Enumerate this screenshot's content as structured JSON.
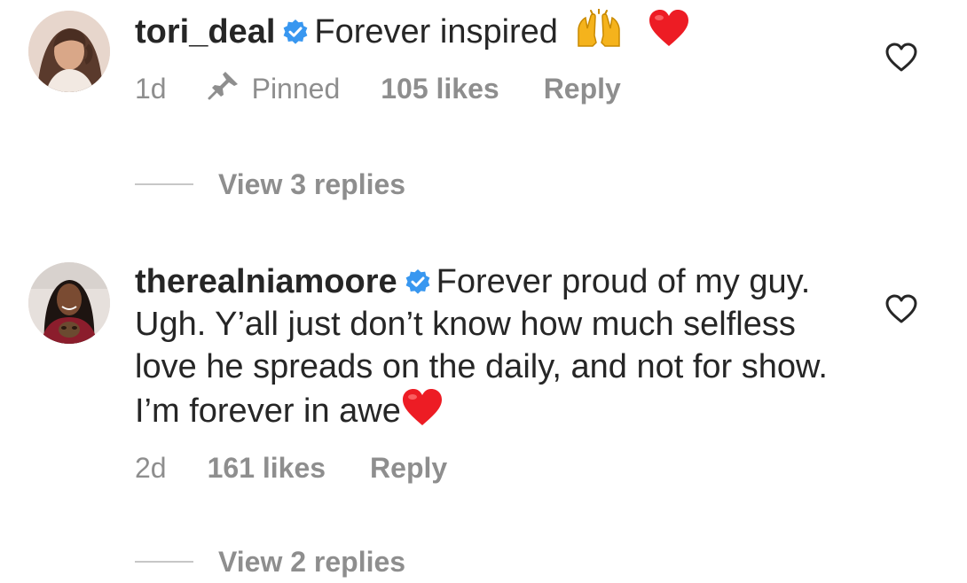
{
  "comments": [
    {
      "username": "tori_deal",
      "avatar": "profile-photo-woman-brown-hair",
      "verified_icon": "verified-badge-icon",
      "text": "Forever inspired",
      "emojis": [
        "raising-hands-emoji",
        "red-heart-emoji"
      ],
      "time": "1d",
      "pinned_label": "Pinned",
      "likes": "105 likes",
      "reply_label": "Reply",
      "view_replies": "View 3 replies"
    },
    {
      "username": "therealniamoore",
      "avatar": "profile-photo-woman-with-dog",
      "verified_icon": "verified-badge-icon",
      "text": "Forever proud of my guy. Ugh. Y’all just don’t know how much selfless love he spreads on the daily, and not for show. I’m forever in awe",
      "emojis": [
        "red-heart-emoji"
      ],
      "time": "2d",
      "likes": "161 likes",
      "reply_label": "Reply",
      "view_replies": "View 2 replies"
    }
  ],
  "colors": {
    "text": "#262626",
    "secondary": "#8e8e8e",
    "verified_blue": "#3897f0",
    "heart_red": "#ed1c24"
  }
}
